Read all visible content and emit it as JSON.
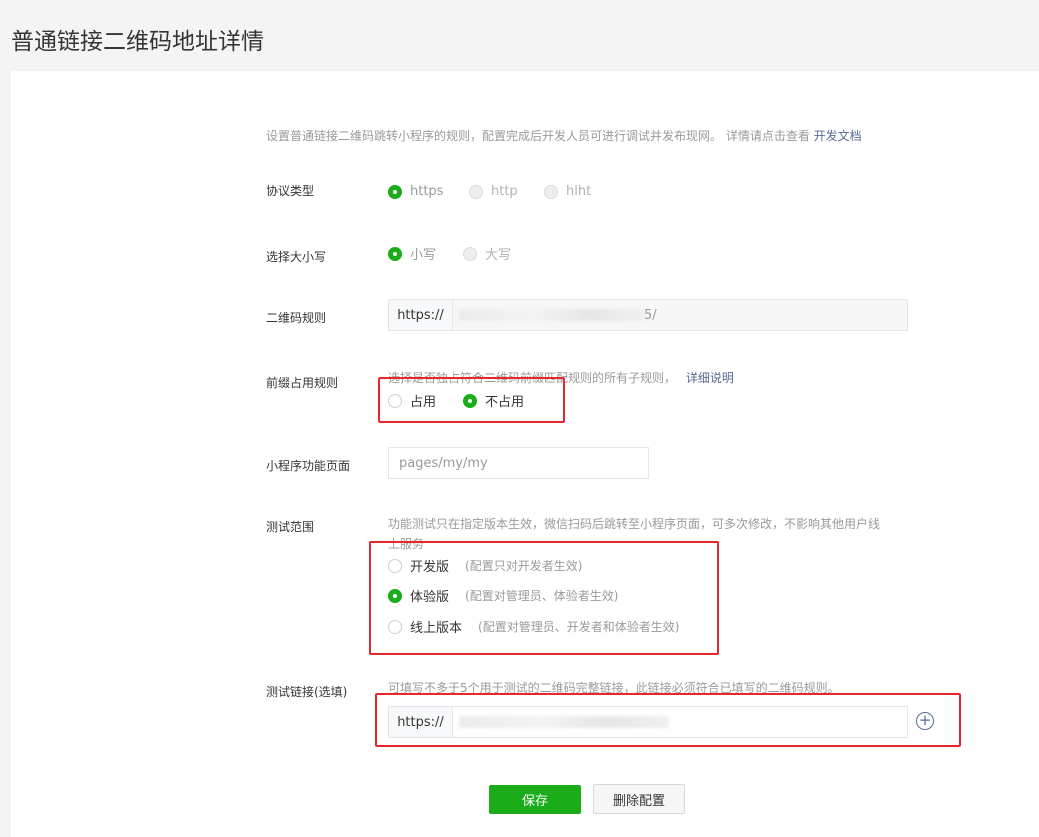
{
  "page": {
    "title": "普通链接二维码地址详情"
  },
  "intro": {
    "text": "设置普通链接二维码跳转小程序的规则，配置完成后开发人员可进行调试并发布现网。 详情请点击查看",
    "link": "开发文档"
  },
  "protocol": {
    "label": "协议类型",
    "options": [
      {
        "label": "https",
        "selected": true
      },
      {
        "label": "http",
        "selected": false
      },
      {
        "label": "hlht",
        "selected": false
      }
    ]
  },
  "case": {
    "label": "选择大小写",
    "options": [
      {
        "label": "小写",
        "selected": true
      },
      {
        "label": "大写",
        "selected": false
      }
    ]
  },
  "qrrule": {
    "label": "二维码规则",
    "prefix": "https://",
    "suffix": "5/"
  },
  "prefix_rule": {
    "label": "前缀占用规则",
    "desc": "选择是否独占符合二维码前缀匹配规则的所有子规则，",
    "link": "详细说明",
    "options": [
      {
        "label": "占用",
        "selected": false
      },
      {
        "label": "不占用",
        "selected": true
      }
    ]
  },
  "page_path": {
    "label": "小程序功能页面",
    "placeholder": "pages/my/my"
  },
  "test_scope": {
    "label": "测试范围",
    "desc_line1": "功能测试只在指定版本生效，微信扫码后跳转至小程序页面，可多次修改，不影响其他用户线",
    "desc_line2": "上服务",
    "options": [
      {
        "label": "开发版",
        "note": "(配置只对开发者生效)",
        "selected": false
      },
      {
        "label": "体验版",
        "note": "(配置对管理员、体验者生效)",
        "selected": true
      },
      {
        "label": "线上版本",
        "note": "(配置对管理员、开发者和体验者生效)",
        "selected": false
      }
    ]
  },
  "test_link": {
    "label": "测试链接(选填)",
    "desc": "可填写不多于5个用于测试的二维码完整链接，此链接必须符合已填写的二维码规则。",
    "prefix": "https://"
  },
  "actions": {
    "save": "保存",
    "delete": "删除配置"
  },
  "colors": {
    "accent": "#1aad19",
    "link": "#576b95",
    "annotation": "#e8262b"
  }
}
